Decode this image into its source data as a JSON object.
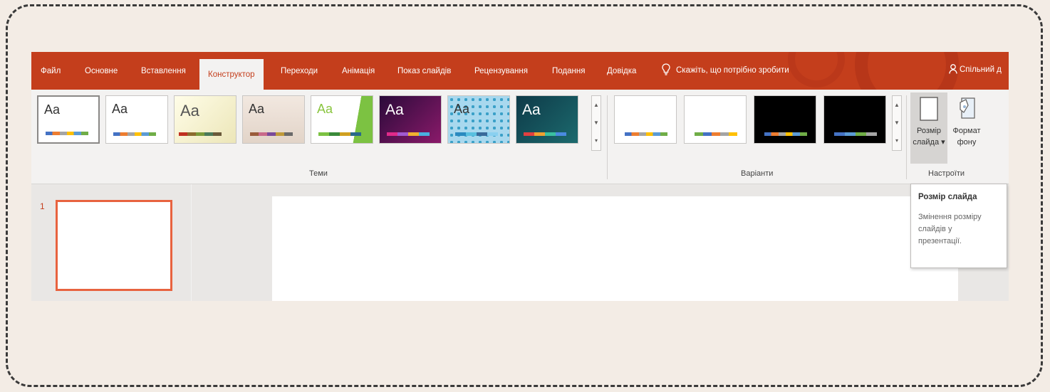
{
  "tabs": [
    {
      "label": "Файл"
    },
    {
      "label": "Основне"
    },
    {
      "label": "Вставлення"
    },
    {
      "label": "Конструктор"
    },
    {
      "label": "Переходи"
    },
    {
      "label": "Анімація"
    },
    {
      "label": "Показ слайдів"
    },
    {
      "label": "Рецензування"
    },
    {
      "label": "Подання"
    },
    {
      "label": "Довідка"
    }
  ],
  "active_tab": "Конструктор",
  "tell_me": "Скажіть, що потрібно зробити",
  "share": "Спільний д",
  "groups": {
    "themes": "Теми",
    "variants": "Варіанти",
    "customize": "Настроїти"
  },
  "theme_thumbs": [
    {
      "label": "Aa"
    },
    {
      "label": "Aa"
    },
    {
      "label": "Aa"
    },
    {
      "label": "Aa"
    },
    {
      "label": "Aa"
    },
    {
      "label": "Aa"
    },
    {
      "label": "Aa"
    },
    {
      "label": "Aa"
    }
  ],
  "buttons": {
    "slide_size_line1": "Розмір",
    "slide_size_line2": "слайда ▾",
    "format_bg_line1": "Формат",
    "format_bg_line2": "фону"
  },
  "slide_number": "1",
  "tooltip": {
    "title": "Розмір слайда",
    "body_line1": "Змінення розміру",
    "body_line2": "слайдів у",
    "body_line3": "презентації."
  },
  "colors": {
    "accent": "#c43e1c",
    "selected_slide_border": "#e8633f"
  }
}
